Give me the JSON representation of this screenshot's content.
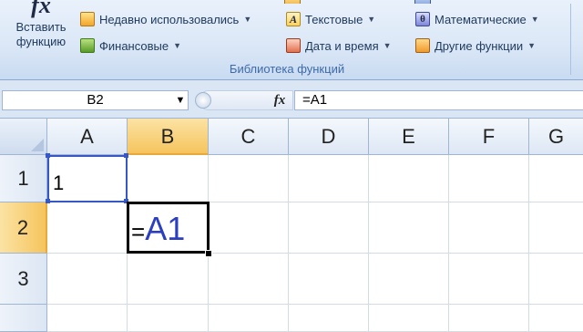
{
  "ribbon": {
    "insert_function": {
      "icon": "fx-icon",
      "label_line1": "Вставить",
      "label_line2": "функцию"
    },
    "buttons": [
      {
        "label": "Недавно использовались",
        "icon": "recent-functions-icon"
      },
      {
        "label": "Финансовые",
        "icon": "financial-functions-icon"
      },
      {
        "label": "Текстовые",
        "icon": "text-functions-icon"
      },
      {
        "label": "Дата и время",
        "icon": "date-time-functions-icon"
      },
      {
        "label": "Математические",
        "icon": "math-functions-icon"
      },
      {
        "label": "Другие функции",
        "icon": "other-functions-icon"
      }
    ],
    "group_label": "Библиотека функций"
  },
  "formula_bar": {
    "name_box": "B2",
    "fx_symbol": "fx",
    "formula": "=A1"
  },
  "grid": {
    "columns": [
      "A",
      "B",
      "C",
      "D",
      "E",
      "F",
      "G"
    ],
    "rows": [
      "1",
      "2",
      "3"
    ],
    "cells": {
      "A1": "1",
      "B2_eq": "=",
      "B2_ref": "A1"
    }
  },
  "colors": {
    "selection_header": "#f6c45d",
    "reference_border": "#3757c7",
    "reference_text": "#2b3fbf"
  }
}
